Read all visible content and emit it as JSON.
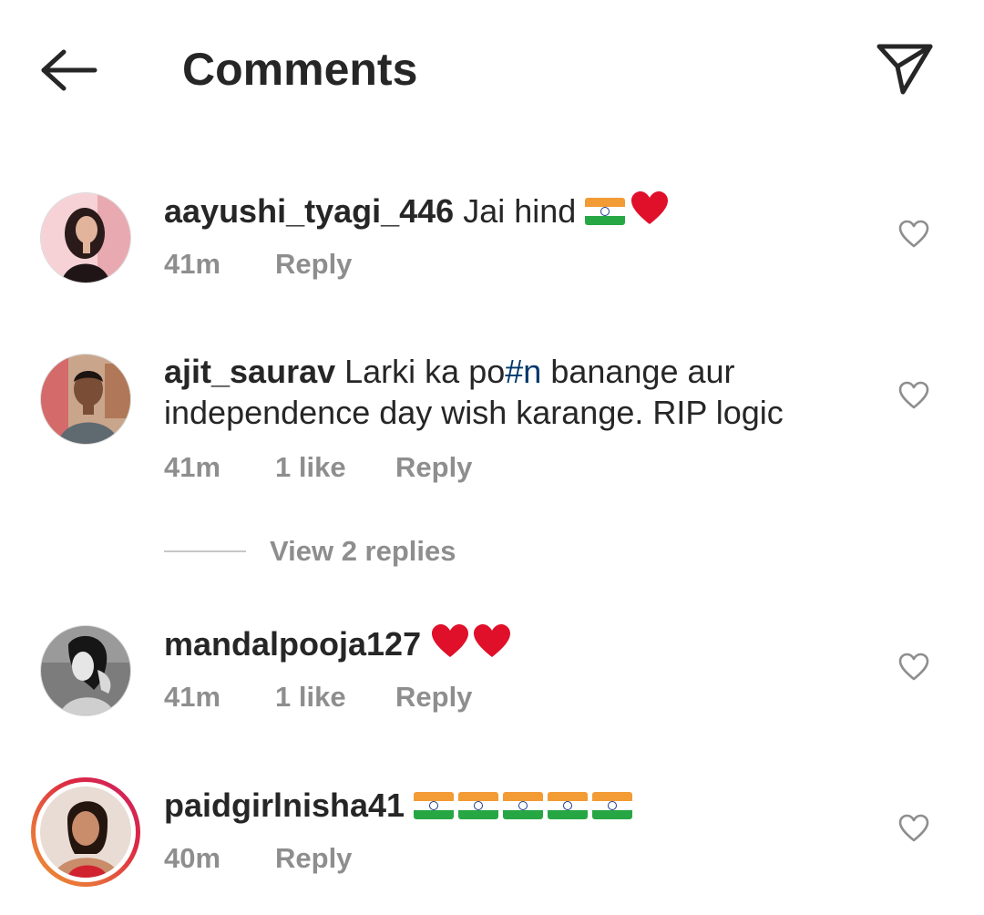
{
  "header": {
    "title": "Comments",
    "back_icon": "arrow-left-icon",
    "share_icon": "paper-plane-icon"
  },
  "colors": {
    "text": "#262626",
    "meta": "#8e8e8e",
    "hashtag": "#00376b",
    "story_ring": "#dc2743"
  },
  "comments": [
    {
      "username": "aayushi_tyagi_446",
      "text": "Jai hind",
      "emojis": [
        "india-flag",
        "red-heart"
      ],
      "time": "41m",
      "likes": "",
      "reply": "Reply"
    },
    {
      "username": "ajit_saurav",
      "text_before": "Larki ka po",
      "hashtag": "#n",
      "text_after": "banange aur independence day wish karange. RIP logic",
      "time": "41m",
      "likes": "1 like",
      "reply": "Reply",
      "view_replies": "View 2 replies"
    },
    {
      "username": "mandalpooja127",
      "emojis": [
        "red-heart",
        "red-heart"
      ],
      "time": "41m",
      "likes": "1 like",
      "reply": "Reply"
    },
    {
      "username": "paidgirlnisha41",
      "emojis": [
        "india-flag",
        "india-flag",
        "india-flag",
        "india-flag",
        "india-flag"
      ],
      "time": "40m",
      "likes": "",
      "reply": "Reply"
    }
  ]
}
